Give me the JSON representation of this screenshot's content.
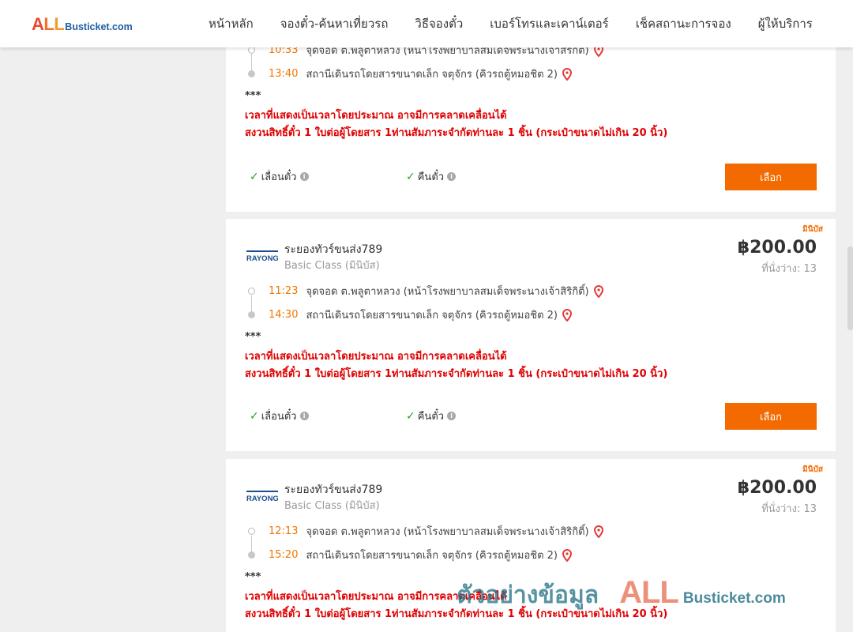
{
  "header": {
    "logo": {
      "all": "ALL",
      "suffix": "Busticket.com"
    },
    "nav": [
      "หน้าหลัก",
      "จองตั๋ว-ค้นหาเที่ยวรถ",
      "วิธีจองตั๋ว",
      "เบอร์โทรและเคาน์เตอร์",
      "เช็คสถานะการจอง",
      "ผู้ให้บริการ"
    ]
  },
  "trips": [
    {
      "company": "",
      "class": "",
      "price": "",
      "seats": "",
      "badge": "",
      "depart_time": "10:33",
      "depart_place": "จุดจอด ต.พลูตาหลวง (หน้าโรงพยาบาลสมเด็จพระนางเจ้าสิริกิติ์)",
      "arrive_time": "13:40",
      "arrive_place": "สถานีเดินรถโดยสารขนาดเล็ก จตุจักร (คิวรถตู้หมอชิต 2)",
      "stars": "***",
      "warn1": "เวลาที่แสดงเป็นเวลาโดยประมาณ อาจมีการคลาดเคลื่อนได้",
      "warn2": "สงวนสิทธิ์ตั๋ว 1 ใบต่อผู้โดยสาร 1ท่านสัมภาระจำกัดท่านละ 1 ชิ้น (กระเป๋าขนาดไม่เกิน 20 นิ้ว)",
      "feature1": "เลื่อนตั๋ว",
      "feature2": "คืนตั๋ว",
      "select": "เลือก"
    },
    {
      "company": "ระยองทัวร์ขนส่ง789",
      "class": "Basic Class (มินิบัส)",
      "price": "฿200.00",
      "seats": "ที่นั่งว่าง: 13",
      "badge": "มินิบัส",
      "depart_time": "11:23",
      "depart_place": "จุดจอด ต.พลูตาหลวง (หน้าโรงพยาบาลสมเด็จพระนางเจ้าสิริกิติ์)",
      "arrive_time": "14:30",
      "arrive_place": "สถานีเดินรถโดยสารขนาดเล็ก จตุจักร (คิวรถตู้หมอชิต 2)",
      "stars": "***",
      "warn1": "เวลาที่แสดงเป็นเวลาโดยประมาณ อาจมีการคลาดเคลื่อนได้",
      "warn2": "สงวนสิทธิ์ตั๋ว 1 ใบต่อผู้โดยสาร 1ท่านสัมภาระจำกัดท่านละ 1 ชิ้น (กระเป๋าขนาดไม่เกิน 20 นิ้ว)",
      "feature1": "เลื่อนตั๋ว",
      "feature2": "คืนตั๋ว",
      "select": "เลือก"
    },
    {
      "company": "ระยองทัวร์ขนส่ง789",
      "class": "Basic Class (มินิบัส)",
      "price": "฿200.00",
      "seats": "ที่นั่งว่าง: 13",
      "badge": "มินิบัส",
      "depart_time": "12:13",
      "depart_place": "จุดจอด ต.พลูตาหลวง (หน้าโรงพยาบาลสมเด็จพระนางเจ้าสิริกิติ์)",
      "arrive_time": "15:20",
      "arrive_place": "สถานีเดินรถโดยสารขนาดเล็ก จตุจักร (คิวรถตู้หมอชิต 2)",
      "stars": "***",
      "warn1": "เวลาที่แสดงเป็นเวลาโดยประมาณ อาจมีการคลาดเคลื่อนได้",
      "warn2": "สงวนสิทธิ์ตั๋ว 1 ใบต่อผู้โดยสาร 1ท่านสัมภาระจำกัดท่านละ 1 ชิ้น (กระเป๋าขนาดไม่เกิน 20 นิ้ว)"
    }
  ],
  "company_logo_text": "RAYONG",
  "watermark": {
    "thai": "ตัวอย่างข้อมูล",
    "all": "ALL",
    "suffix": "Busticket.com"
  },
  "colors": {
    "accent": "#f36b00",
    "warning": "#e00000",
    "time": "#f07800",
    "pin": "#e53935"
  }
}
